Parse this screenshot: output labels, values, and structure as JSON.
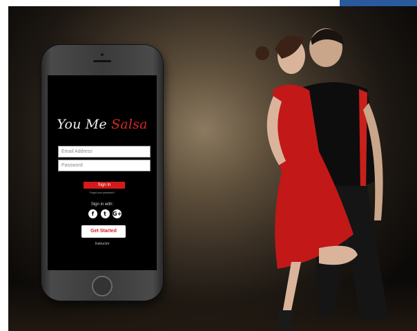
{
  "app": {
    "logo_part1": "You Me ",
    "logo_part2": "Salsa",
    "accent_color": "#d41a1a"
  },
  "login": {
    "email_placeholder": "Email Address",
    "password_placeholder": "Password",
    "signin_label": "Sign In",
    "forgot_label": "Forgot your password?",
    "signin_with_label": "Sign in with:",
    "social": [
      {
        "name": "facebook-icon",
        "glyph": "f"
      },
      {
        "name": "twitter-icon",
        "glyph": "t"
      },
      {
        "name": "google-plus-icon",
        "glyph": "G+"
      }
    ],
    "get_started_label": "Get Started",
    "instructor_label": "Instructor"
  }
}
